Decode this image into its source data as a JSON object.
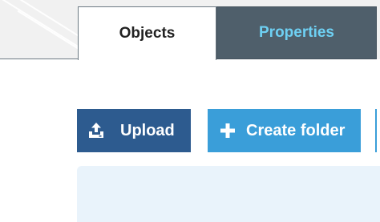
{
  "tabs": {
    "objects_label": "Objects",
    "properties_label": "Properties"
  },
  "toolbar": {
    "upload_label": "Upload",
    "upload_icon": "upload-icon",
    "create_folder_label": "Create folder",
    "create_folder_icon": "plus-icon"
  },
  "colors": {
    "active_tab_bg": "#ffffff",
    "inactive_tab_bg": "#4f5f6b",
    "inactive_tab_text": "#6ed0f3",
    "upload_button_bg": "#2d5b8f",
    "create_button_bg": "#3a9ed9",
    "drop_zone_bg": "#e9f3fb"
  }
}
